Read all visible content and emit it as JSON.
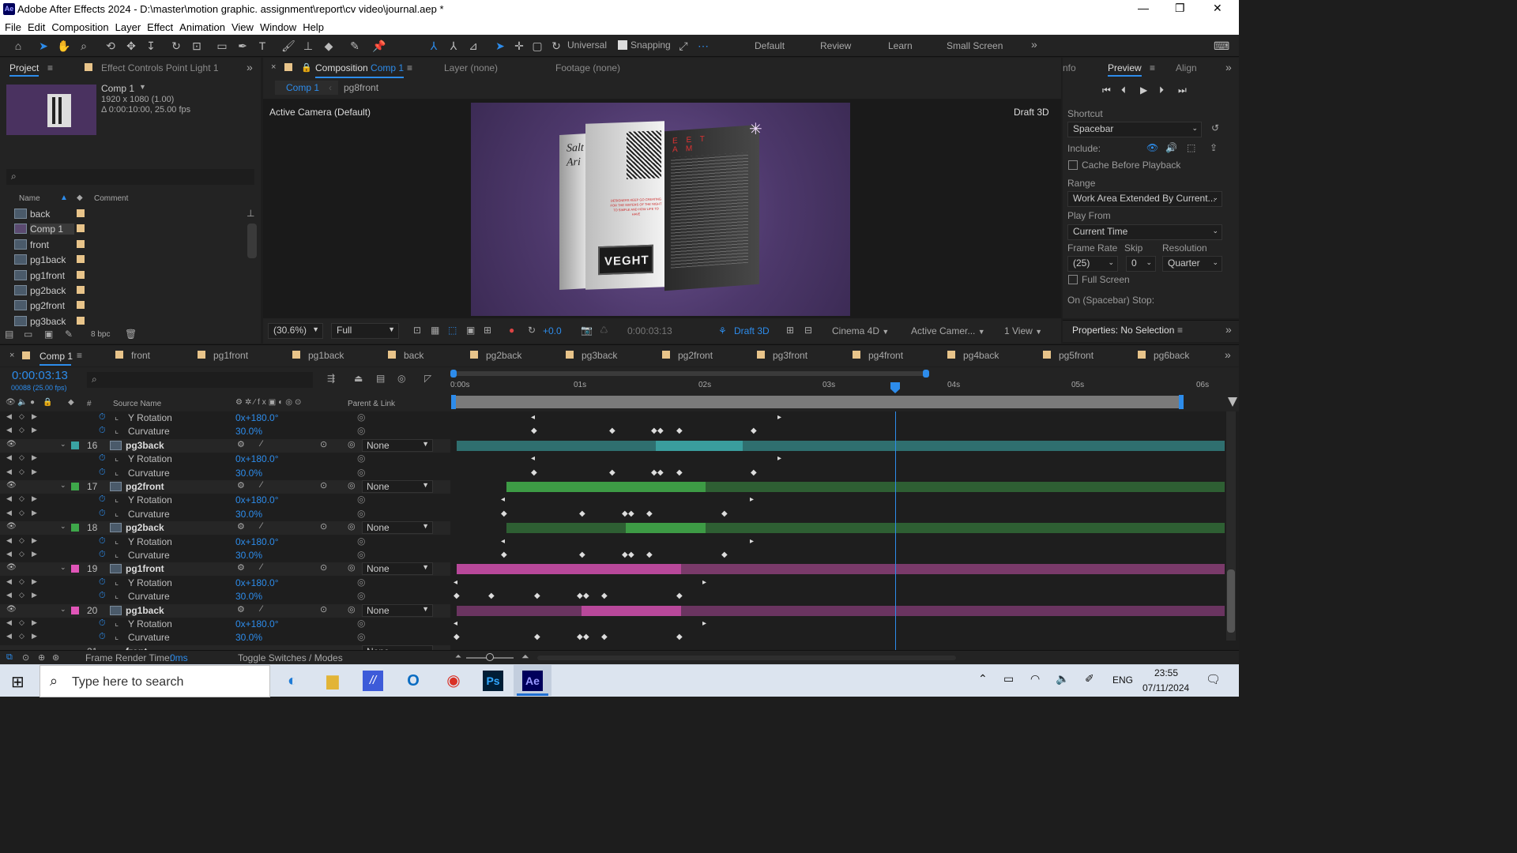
{
  "window": {
    "title": "Adobe After Effects 2024 - D:\\master\\motion graphic. assignment\\report\\cv video\\journal.aep *",
    "logo_text": "Ae",
    "min": "—",
    "max": "❐",
    "close": "✕"
  },
  "menu": [
    "File",
    "Edit",
    "Composition",
    "Layer",
    "Effect",
    "Animation",
    "View",
    "Window",
    "Help"
  ],
  "toolbar": {
    "universal": "Universal",
    "snapping": "Snapping",
    "workspaces": [
      "Default",
      "Review",
      "Learn",
      "Small Screen"
    ],
    "more": "»"
  },
  "project": {
    "tab_project": "Project",
    "tab_effects": "Effect Controls Point Light 1",
    "comp_name": "Comp 1",
    "comp_res": "1920 x 1080 (1.00)",
    "comp_dur": "Δ 0:00:10:00, 25.00 fps",
    "col_name": "Name",
    "col_comment": "Comment",
    "items": [
      "back",
      "Comp 1",
      "front",
      "pg1back",
      "pg1front",
      "pg2back",
      "pg2front",
      "pg3back"
    ],
    "bpc": "8 bpc"
  },
  "composition": {
    "tab_label": "Composition",
    "tab_comp": "Comp 1",
    "layer_tab": "Layer  (none)",
    "footage_tab": "Footage  (none)",
    "crumb_comp": "Comp 1",
    "crumb_sub": "pg8front",
    "camera": "Active Camera (Default)",
    "draft": "Draft 3D",
    "zoom": "(30.6%)",
    "quality": "Full",
    "exposure": "+0.0",
    "time": "0:00:03:13",
    "draft3d": "Draft 3D",
    "renderer": "Cinema 4D",
    "camera_dd": "Active Camer...",
    "views": "1 View",
    "page_left_text": "Salt Ari",
    "page_red_text": "DESIGNERS KEEP GO CREATING FOR THE SISTERS OF THE NIGHT TO SIMPLE AND HOW LIFE TO HAVE",
    "page_right_head": "E E T A M",
    "page_box_text": "VEGHT"
  },
  "preview": {
    "tab_info": "nfo",
    "tab_preview": "Preview",
    "tab_align": "Align",
    "shortcut_label": "Shortcut",
    "shortcut": "Spacebar",
    "include_label": "Include:",
    "cache": "Cache Before Playback",
    "range_label": "Range",
    "range": "Work Area Extended By Current...",
    "playfrom_label": "Play From",
    "playfrom": "Current Time",
    "framerate_label": "Frame Rate",
    "skip_label": "Skip",
    "resolution_label": "Resolution",
    "framerate": "(25)",
    "skip": "0",
    "resolution": "Quarter",
    "fullscreen": "Full Screen",
    "onstop": "On (Spacebar) Stop:",
    "properties": "Properties: No Selection"
  },
  "timeline": {
    "tabs": [
      "Comp 1",
      "front",
      "pg1front",
      "pg1back",
      "back",
      "pg2back",
      "pg3back",
      "pg2front",
      "pg3front",
      "pg4front",
      "pg4back",
      "pg5front",
      "pg6back"
    ],
    "time": "0:00:03:13",
    "frames": "00088 (25.00 fps)",
    "col_num": "#",
    "col_source": "Source Name",
    "col_parent": "Parent & Link",
    "ruler": [
      "0:00s",
      "01s",
      "02s",
      "03s",
      "04s",
      "05s",
      "06s"
    ],
    "current_time_s": 3.52,
    "layers": [
      {
        "kind": "prop",
        "name": "Y Rotation",
        "value": "0x+180.0°"
      },
      {
        "kind": "prop",
        "name": "Curvature",
        "value": "30.0%"
      },
      {
        "kind": "layer",
        "num": "16",
        "name": "pg3back",
        "parent": "None",
        "color": "#3aa3a3"
      },
      {
        "kind": "prop",
        "name": "Y Rotation",
        "value": "0x+180.0°"
      },
      {
        "kind": "prop",
        "name": "Curvature",
        "value": "30.0%"
      },
      {
        "kind": "layer",
        "num": "17",
        "name": "pg2front",
        "parent": "None",
        "color": "#3ea84a"
      },
      {
        "kind": "prop",
        "name": "Y Rotation",
        "value": "0x+180.0°"
      },
      {
        "kind": "prop",
        "name": "Curvature",
        "value": "30.0%"
      },
      {
        "kind": "layer",
        "num": "18",
        "name": "pg2back",
        "parent": "None",
        "color": "#3ea84a"
      },
      {
        "kind": "prop",
        "name": "Y Rotation",
        "value": "0x+180.0°"
      },
      {
        "kind": "prop",
        "name": "Curvature",
        "value": "30.0%"
      },
      {
        "kind": "layer",
        "num": "19",
        "name": "pg1front",
        "parent": "None",
        "color": "#e055b8"
      },
      {
        "kind": "prop",
        "name": "Y Rotation",
        "value": "0x+180.0°"
      },
      {
        "kind": "prop",
        "name": "Curvature",
        "value": "30.0%"
      },
      {
        "kind": "layer",
        "num": "20",
        "name": "pg1back",
        "parent": "None",
        "color": "#e055b8"
      },
      {
        "kind": "prop",
        "name": "Y Rotation",
        "value": "0x+180.0°"
      },
      {
        "kind": "prop",
        "name": "Curvature",
        "value": "30.0%"
      }
    ],
    "next_row_partial": {
      "num": "21",
      "name": "front",
      "parent": "None"
    },
    "render_time_label": "Frame Render Time:",
    "render_time": "0ms",
    "toggle": "Toggle Switches / Modes"
  },
  "taskbar": {
    "search": "Type here to search",
    "lang": "ENG",
    "time": "23:55",
    "date": "07/11/2024"
  }
}
